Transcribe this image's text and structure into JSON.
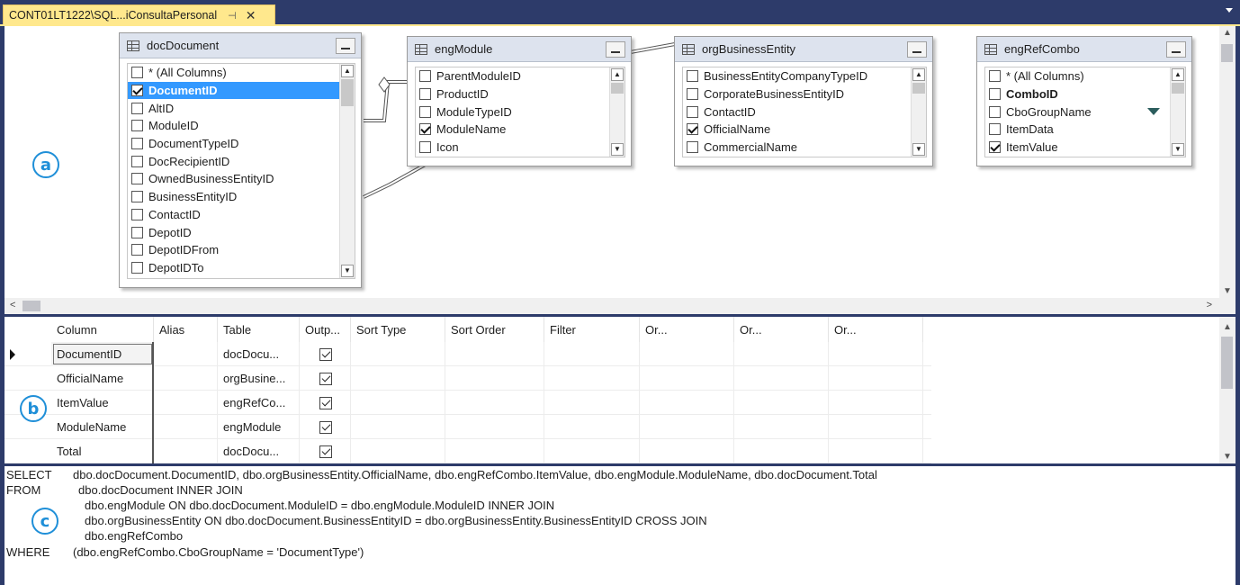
{
  "tab": {
    "title": "CONT01LT1222\\SQL...iConsultaPersonal",
    "pin_glyph": "⊣",
    "close_glyph": "✕"
  },
  "markers": {
    "a": "a",
    "b": "b",
    "c": "c"
  },
  "tables": {
    "docDocument": {
      "name": "docDocument",
      "columns": [
        {
          "label": "* (All Columns)",
          "checked": false
        },
        {
          "label": "DocumentID",
          "checked": true,
          "selected": true
        },
        {
          "label": "AltID",
          "checked": false
        },
        {
          "label": "ModuleID",
          "checked": false
        },
        {
          "label": "DocumentTypeID",
          "checked": false
        },
        {
          "label": "DocRecipientID",
          "checked": false
        },
        {
          "label": "OwnedBusinessEntityID",
          "checked": false
        },
        {
          "label": "BusinessEntityID",
          "checked": false
        },
        {
          "label": "ContactID",
          "checked": false
        },
        {
          "label": "DepotID",
          "checked": false
        },
        {
          "label": "DepotIDFrom",
          "checked": false
        },
        {
          "label": "DepotIDTo",
          "checked": false
        }
      ]
    },
    "engModule": {
      "name": "engModule",
      "columns": [
        {
          "label": "ParentModuleID",
          "checked": false
        },
        {
          "label": "ProductID",
          "checked": false
        },
        {
          "label": "ModuleTypeID",
          "checked": false
        },
        {
          "label": "ModuleName",
          "checked": true
        },
        {
          "label": "Icon",
          "checked": false
        }
      ]
    },
    "orgBusinessEntity": {
      "name": "orgBusinessEntity",
      "columns": [
        {
          "label": "BusinessEntityCompanyTypeID",
          "checked": false
        },
        {
          "label": "CorporateBusinessEntityID",
          "checked": false
        },
        {
          "label": "ContactID",
          "checked": false
        },
        {
          "label": "OfficialName",
          "checked": true
        },
        {
          "label": "CommercialName",
          "checked": false
        }
      ]
    },
    "engRefCombo": {
      "name": "engRefCombo",
      "columns": [
        {
          "label": "* (All Columns)",
          "checked": false
        },
        {
          "label": "ComboID",
          "checked": false,
          "bold": true
        },
        {
          "label": "CboGroupName",
          "checked": false,
          "filter": true
        },
        {
          "label": "ItemData",
          "checked": false
        },
        {
          "label": "ItemValue",
          "checked": true
        }
      ]
    }
  },
  "grid": {
    "headers": [
      "Column",
      "Alias",
      "Table",
      "Outp...",
      "Sort Type",
      "Sort Order",
      "Filter",
      "Or...",
      "Or...",
      "Or..."
    ],
    "rows": [
      {
        "column": "DocumentID",
        "alias": "",
        "table": "docDocu...",
        "output": true
      },
      {
        "column": "OfficialName",
        "alias": "",
        "table": "orgBusine...",
        "output": true
      },
      {
        "column": "ItemValue",
        "alias": "",
        "table": "engRefCo...",
        "output": true
      },
      {
        "column": "ModuleName",
        "alias": "",
        "table": "engModule",
        "output": true
      },
      {
        "column": "Total",
        "alias": "",
        "table": "docDocu...",
        "output": true
      }
    ]
  },
  "sql": {
    "lines": [
      {
        "kw": "SELECT",
        "text": "dbo.docDocument.DocumentID, dbo.orgBusinessEntity.OfficialName, dbo.engRefCombo.ItemValue, dbo.engModule.ModuleName, dbo.docDocument.Total"
      },
      {
        "kw": "FROM",
        "text": "dbo.docDocument INNER JOIN"
      },
      {
        "kw": "",
        "text": "dbo.engModule ON dbo.docDocument.ModuleID = dbo.engModule.ModuleID INNER JOIN"
      },
      {
        "kw": "",
        "text": "dbo.orgBusinessEntity ON dbo.docDocument.BusinessEntityID = dbo.orgBusinessEntity.BusinessEntityID CROSS JOIN"
      },
      {
        "kw": "",
        "text": "dbo.engRefCombo"
      },
      {
        "kw": "WHERE",
        "text": "(dbo.engRefCombo.CboGroupName = 'DocumentType')"
      }
    ]
  },
  "colors": {
    "tab_bg": "#ffe88d",
    "chrome": "#2d3b6a",
    "selection": "#3399ff",
    "marker": "#1f8fd8"
  }
}
